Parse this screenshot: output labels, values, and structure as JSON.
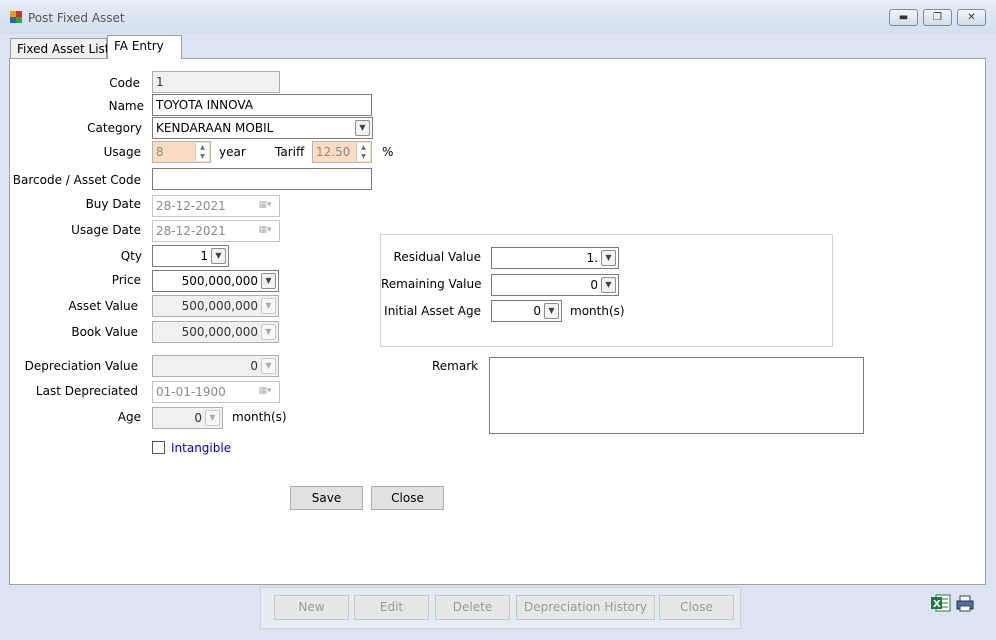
{
  "window": {
    "title": "Post Fixed Asset"
  },
  "tabs": [
    {
      "label": "Fixed Asset List"
    },
    {
      "label": "FA Entry"
    }
  ],
  "form": {
    "code_label": "Code",
    "code_value": "1",
    "name_label": "Name",
    "name_value": "TOYOTA INNOVA",
    "category_label": "Category",
    "category_value": "KENDARAAN MOBIL",
    "usage_label": "Usage",
    "usage_value": "8",
    "usage_unit": "year",
    "tariff_label": "Tariff",
    "tariff_value": "12.50",
    "tariff_unit": "%",
    "barcode_label": "Barcode / Asset Code",
    "barcode_value": "",
    "buy_date_label": "Buy Date",
    "buy_date_value": "28-12-2021",
    "usage_date_label": "Usage Date",
    "usage_date_value": "28-12-2021",
    "qty_label": "Qty",
    "qty_value": "1",
    "price_label": "Price",
    "price_value": "500,000,000",
    "asset_value_label": "Asset Value",
    "asset_value_value": "500,000,000",
    "book_value_label": "Book Value",
    "book_value_value": "500,000,000",
    "depreciation_value_label": "Depreciation Value",
    "depreciation_value_value": "0",
    "last_depreciated_label": "Last Depreciated",
    "last_depreciated_value": "01-01-1900",
    "age_label": "Age",
    "age_value": "0",
    "age_unit": "month(s)",
    "intangible_label": "Intangible",
    "intangible_checked": false,
    "residual_value_label": "Residual Value",
    "residual_value_value": "1.",
    "remaining_value_label": "Remaining Value",
    "remaining_value_value": "0",
    "initial_asset_age_label": "Initial Asset Age",
    "initial_asset_age_value": "0",
    "initial_asset_age_unit": "month(s)",
    "remark_label": "Remark",
    "remark_value": ""
  },
  "actions": {
    "save_label": "Save",
    "close_label": "Close"
  },
  "toolbar": {
    "new_label": "New",
    "edit_label": "Edit",
    "delete_label": "Delete",
    "depreciation_history_label": "Depreciation History",
    "close_label": "Close"
  },
  "icons": {
    "app": "app-icon",
    "minimize": "minimize-icon",
    "restore": "restore-icon",
    "close": "close-icon",
    "excel": "excel-icon",
    "print": "printer-icon"
  },
  "colors": {
    "highlight_field": "#fbdcc0",
    "link_text": "#0000cc"
  }
}
